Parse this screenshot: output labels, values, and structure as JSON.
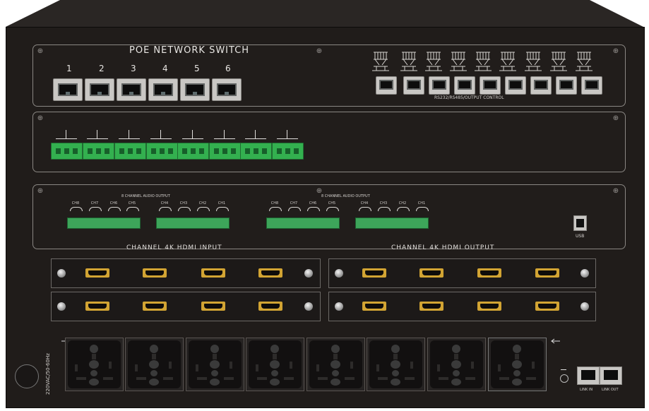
{
  "switch_panel": {
    "title": "POE NETWORK SWITCH",
    "port_numbers": [
      "1",
      "2",
      "3",
      "4",
      "5",
      "6"
    ],
    "control_label": "RS232/RS485/OUTPUT CONTROL"
  },
  "audio_panel": {
    "group_labels": [
      "8 CHANNEL AUDIO OUTPUT",
      "8 CHANNEL AUDIO OUTPUT"
    ],
    "channel_labels": [
      "CH8",
      "CH7",
      "CH6",
      "CH5",
      "CH4",
      "CH3",
      "CH2",
      "CH1"
    ],
    "usb_label": "USB"
  },
  "hdmi": {
    "input_label": "CHANNEL 4K HDMI INPUT",
    "output_label": "CHANNEL 4K HDMI OUTPUT"
  },
  "power": {
    "voltage_label": "220VAC/50-60Hz",
    "link_in_label": "LINK IN",
    "link_out_label": "LINK OUT"
  },
  "colors": {
    "panel": "#201c1a",
    "terminal_green": "#33b04f",
    "hdmi_gold": "#d2a433"
  }
}
